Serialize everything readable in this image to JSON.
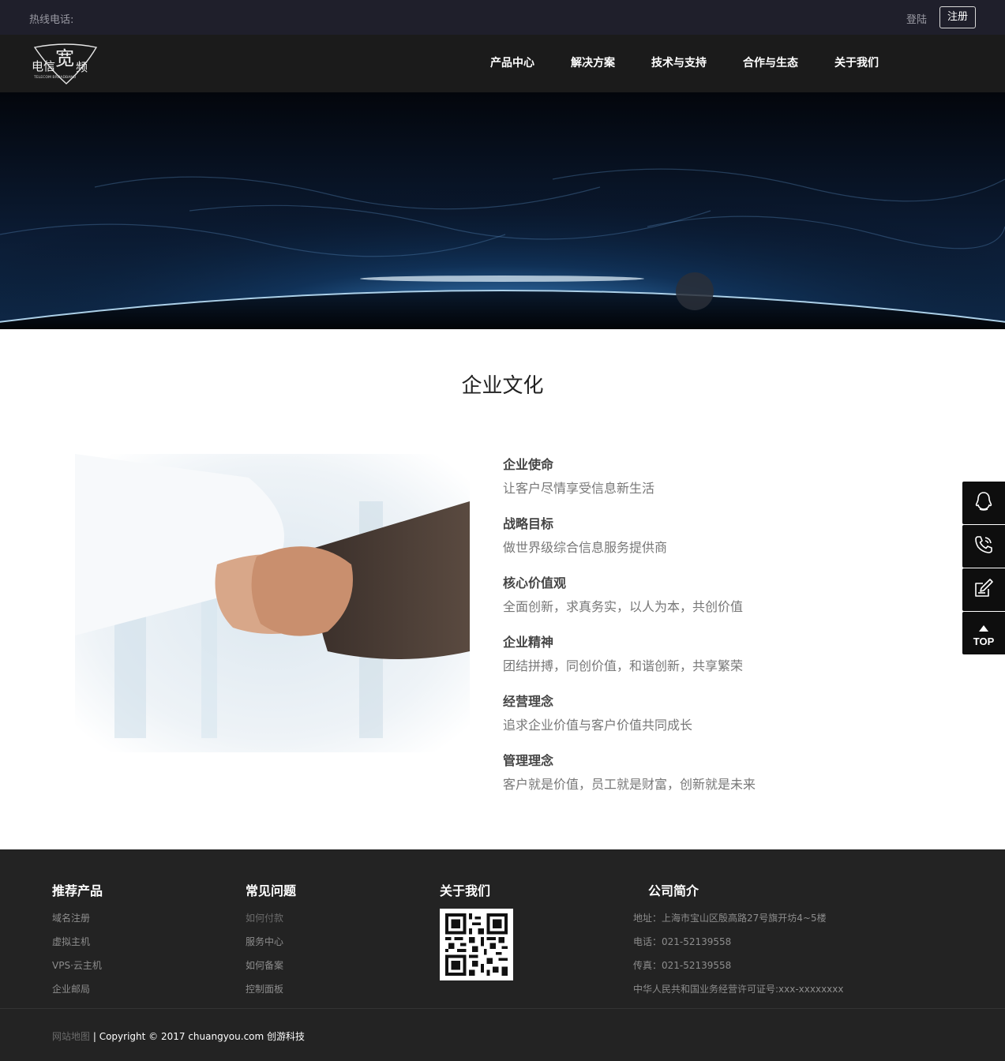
{
  "topbar": {
    "hotline_label": "热线电话:",
    "login_label": "登陆",
    "register_label": "注册"
  },
  "header": {
    "nav": [
      "产品中心",
      "解决方案",
      "技术与支持",
      "合作与生态",
      "关于我们"
    ]
  },
  "logo": {
    "text_main": "电信宽频",
    "text_sub": "TELECOM BROADBAND"
  },
  "culture": {
    "title": "企业文化",
    "items": [
      {
        "heading": "企业使命",
        "text": "让客户尽情享受信息新生活"
      },
      {
        "heading": "战略目标",
        "text": "做世界级综合信息服务提供商"
      },
      {
        "heading": "核心价值观",
        "text": "全面创新，求真务实，以人为本，共创价值"
      },
      {
        "heading": "企业精神",
        "text": "团结拼搏，同创价值，和谐创新，共享繁荣"
      },
      {
        "heading": "经营理念",
        "text": "追求企业价值与客户价值共同成长"
      },
      {
        "heading": "管理理念",
        "text": "客户就是价值，员工就是财富，创新就是未来"
      }
    ]
  },
  "side_tools": {
    "icons": [
      "qq-icon",
      "phone-icon",
      "edit-icon",
      "arrow-up-icon"
    ],
    "top_label": "TOP"
  },
  "footer": {
    "products": {
      "title": "推荐产品",
      "links": [
        "域名注册",
        "虚拟主机",
        "VPS·云主机",
        "企业邮局"
      ]
    },
    "faq": {
      "title": "常见问题",
      "links": [
        "如何付款",
        "服务中心",
        "如何备案",
        "控制面板"
      ]
    },
    "about": {
      "title": "关于我们"
    },
    "company": {
      "title": "公司简介",
      "lines": [
        "地址：上海市宝山区殷高路27号旗开坊4~5楼",
        "电话：021-52139558",
        "传真：021-52139558",
        "中华人民共和国业务经营许可证号:xxx-xxxxxxxx"
      ]
    },
    "sitemap_label": "网站地图",
    "copyright": "| Copyright © 2017 chuangyou.com 创游科技"
  },
  "colors": {
    "topbar_bg": "#1f1f2b",
    "header_bg": "#1b1b1b",
    "footer_bg": "#232323",
    "side_btn_bg": "#0e0e0e"
  }
}
